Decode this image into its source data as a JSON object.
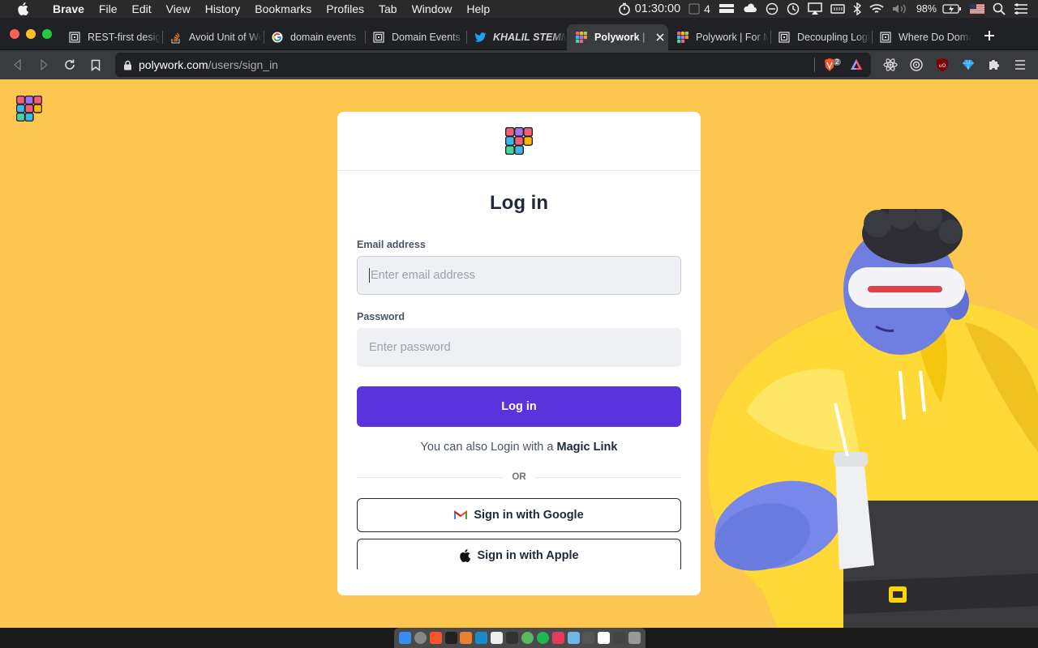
{
  "menubar": {
    "app_name": "Brave",
    "items": [
      "File",
      "Edit",
      "View",
      "History",
      "Bookmarks",
      "Profiles",
      "Tab",
      "Window",
      "Help"
    ],
    "timer": "01:30:00",
    "workspace_count": "4",
    "battery": "98%"
  },
  "tabs": [
    {
      "label": "REST-first design",
      "icon": "spiral-icon"
    },
    {
      "label": "Avoid Unit of Work",
      "icon": "stackoverflow-icon"
    },
    {
      "label": "domain events",
      "icon": "google-icon"
    },
    {
      "label": "Domain Events",
      "icon": "spiral-icon"
    },
    {
      "label": "KHALIL STEMMLER",
      "icon": "twitter-icon"
    },
    {
      "label": "Polywork | Polywork",
      "icon": "polywork-icon"
    },
    {
      "label": "Polywork | For Multiple",
      "icon": "polywork-icon"
    },
    {
      "label": "Decoupling Logic",
      "icon": "spiral-icon"
    },
    {
      "label": "Where Do Domain",
      "icon": "spiral-icon"
    }
  ],
  "address": {
    "host": "polywork.com",
    "path": "/users/sign_in"
  },
  "brave_badge": "2",
  "login": {
    "title": "Log in",
    "email_label": "Email address",
    "email_placeholder": "Enter email address",
    "password_label": "Password",
    "password_placeholder": "Enter password",
    "submit": "Log in",
    "magic_prefix": "You can also Login with a",
    "magic_link": "Magic Link",
    "or": "OR",
    "google": "Sign in with Google",
    "apple": "Sign in with Apple"
  },
  "colors": {
    "page_bg": "#fdc64e",
    "primary": "#5b33dc"
  }
}
